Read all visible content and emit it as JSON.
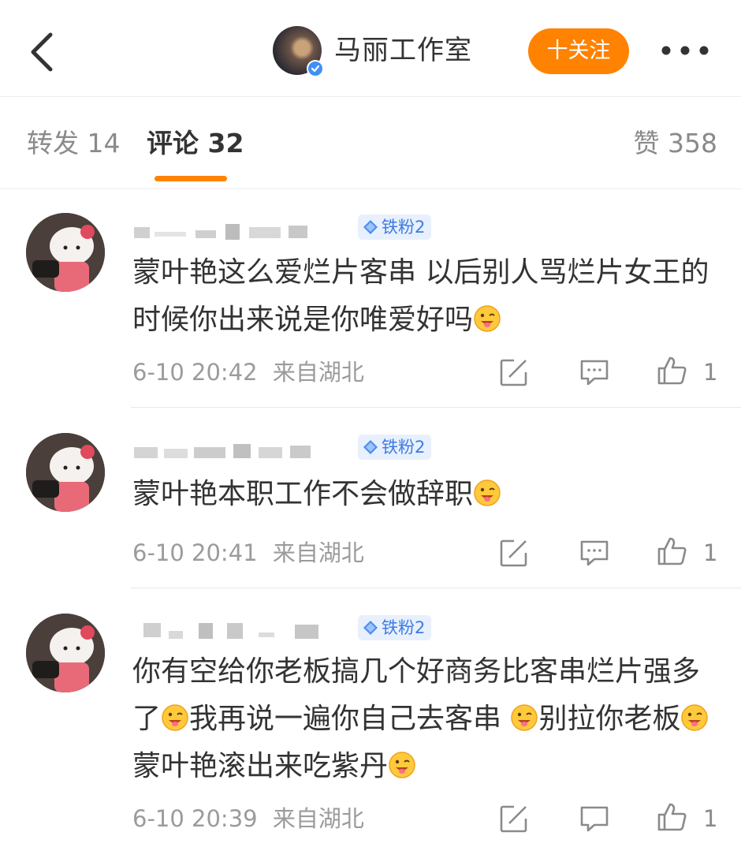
{
  "header": {
    "account_name": "马丽工作室",
    "follow_label": "十关注"
  },
  "tabs": {
    "repost": "转发 14",
    "comments": "评论 32",
    "likes": "赞 358"
  },
  "comments": [
    {
      "badge": "铁粉2",
      "text": "蒙叶艳这么爱烂片客串 以后别人骂烂片女王的时候你出来说是你唯爱好吗",
      "time": "6-10 20:42",
      "location": "来自湖北",
      "likes": "1"
    },
    {
      "badge": "铁粉2",
      "text": "蒙叶艳本职工作不会做辞职",
      "time": "6-10 20:41",
      "location": "来自湖北",
      "likes": "1"
    },
    {
      "badge": "铁粉2",
      "text_parts": [
        "你有空给你老板搞几个好商务比客串烂片强多了",
        "我再说一遍你自己去客串 ",
        "别拉你老板",
        "蒙叶艳滚出来吃紫丹"
      ],
      "time": "6-10 20:39",
      "location": "来自湖北",
      "likes": "1"
    }
  ],
  "colors": {
    "accent": "#ff8200",
    "badge_bg": "#e8f0fd",
    "badge_text": "#3d7be3"
  },
  "icons": [
    "back-icon",
    "verified-icon",
    "more-icon",
    "repost-icon",
    "comment-icon",
    "like-icon",
    "emoji-smile-icon",
    "diamond-icon"
  ]
}
